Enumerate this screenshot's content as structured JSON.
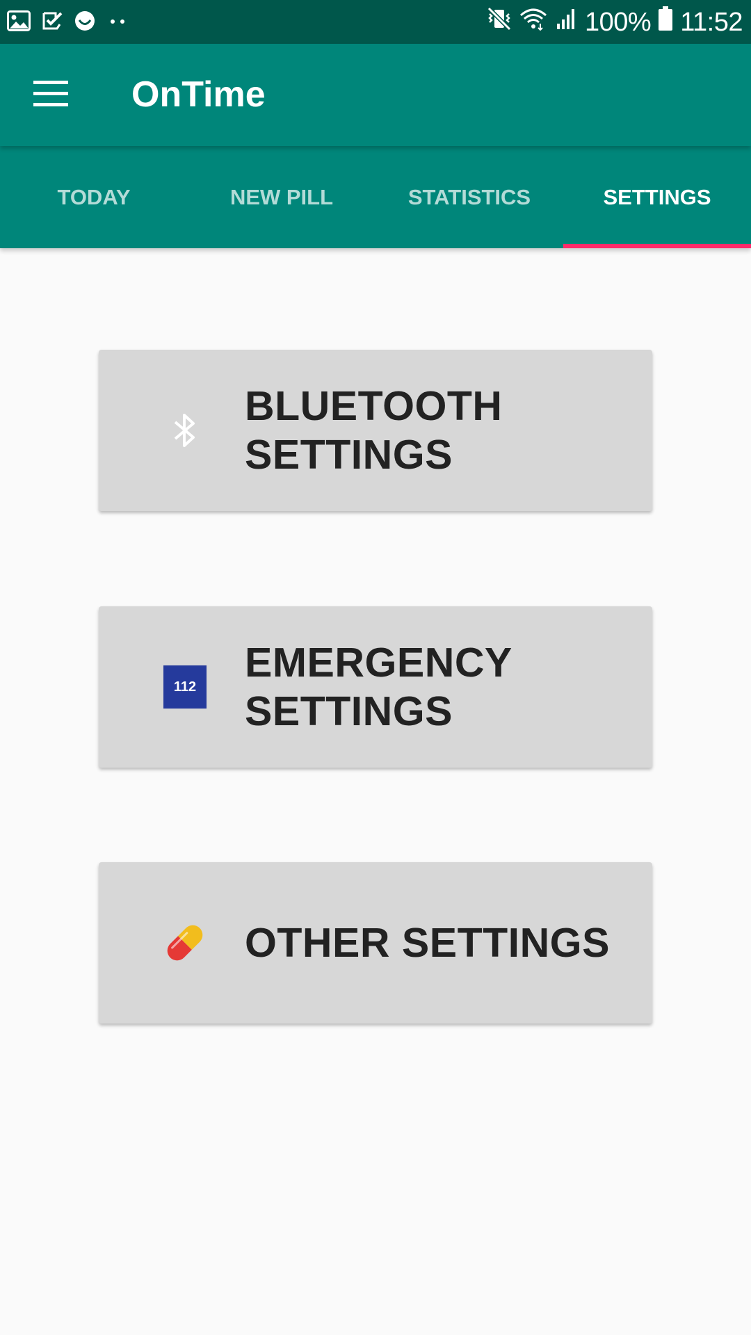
{
  "status_bar": {
    "left_icons": [
      "gallery-icon",
      "task-check-icon",
      "smiley-icon",
      "more-dots-icon"
    ],
    "right_icons": [
      "vibrate-mute-icon",
      "wifi-icon",
      "signal-icon",
      "battery-icon"
    ],
    "battery": "100%",
    "time": "11:52"
  },
  "app_bar": {
    "title": "OnTime",
    "menu_icon": "hamburger-menu-icon"
  },
  "tabs": [
    {
      "label": "TODAY",
      "active": false
    },
    {
      "label": "NEW PILL",
      "active": false
    },
    {
      "label": "STATISTICS",
      "active": false
    },
    {
      "label": "SETTINGS",
      "active": true
    }
  ],
  "settings": {
    "bluetooth": {
      "line1": "BLUETOOTH",
      "line2": "SETTINGS",
      "icon": "bluetooth-icon"
    },
    "emergency": {
      "line1": "EMERGENCY",
      "line2": "SETTINGS",
      "icon": "emergency-112-icon",
      "badge": "112"
    },
    "other": {
      "line1": "OTHER SETTINGS",
      "icon": "pill-capsule-icon"
    }
  },
  "colors": {
    "status_bar": "#00574b",
    "primary": "#00867a",
    "tab_indicator": "#ff2a6a",
    "card_background": "#d7d7d7",
    "page_background": "#fafafa",
    "badge_112": "#253a9c"
  }
}
